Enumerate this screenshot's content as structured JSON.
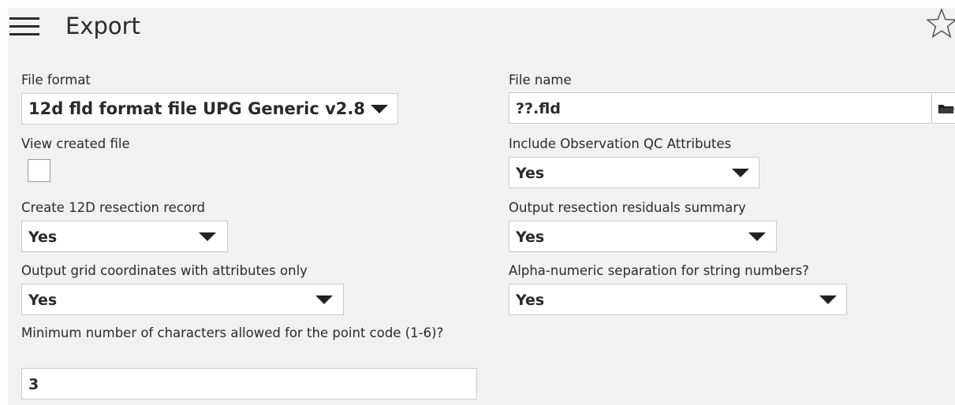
{
  "header": {
    "title": "Export"
  },
  "icons": {
    "menu": "hamburger-menu-icon",
    "favorite": "star-outline-icon",
    "browse": "folder-icon",
    "dropdown": "triangle-down-icon"
  },
  "colors": {
    "panel_background": "#f1f1f1",
    "field_background": "#ffffff",
    "field_border": "#c9c9c9",
    "text": "#2a2a2a"
  },
  "form": {
    "file_format": {
      "label": "File format",
      "value": "12d fld format file UPG Generic v2.8"
    },
    "view_created_file": {
      "label": "View created file",
      "checked": false
    },
    "create_resection_record": {
      "label": "Create 12D resection record",
      "value": "Yes"
    },
    "output_grid_coordinates": {
      "label": "Output grid coordinates with attributes only",
      "value": "Yes"
    },
    "min_characters_point_code": {
      "label": "Minimum number of characters allowed for the point code (1-6)?",
      "value": "3"
    },
    "file_name": {
      "label": "File name",
      "value": "??.fld"
    },
    "include_observation_qc": {
      "label": "Include Observation QC Attributes",
      "value": "Yes"
    },
    "output_resection_residuals": {
      "label": "Output resection residuals summary",
      "value": "Yes"
    },
    "alpha_numeric_separation": {
      "label": "Alpha-numeric separation for string numbers?",
      "value": "Yes"
    }
  }
}
